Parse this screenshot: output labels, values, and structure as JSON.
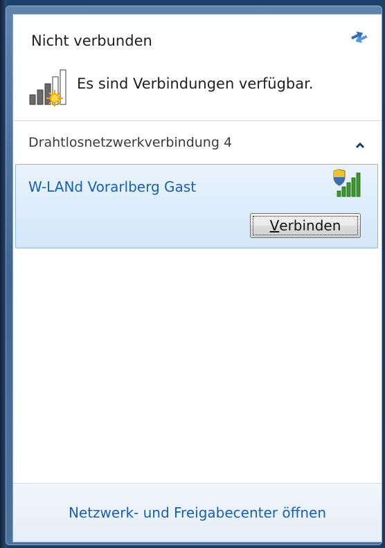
{
  "status": {
    "title": "Nicht verbunden",
    "message": "Es sind Verbindungen verfügbar.",
    "icon": "signal-warning-icon"
  },
  "refresh": {
    "icon": "refresh-arrows-icon"
  },
  "section": {
    "label": "Drahtlosnetzwerkverbindung 4",
    "collapse_icon": "chevron-up-icon"
  },
  "networks": [
    {
      "name": "W-LANd Vorarlberg Gast",
      "secured_icon": "shield-signal-icon",
      "signal_level": "5/5",
      "connect_label_accel": "V",
      "connect_label_rest": "erbinden"
    }
  ],
  "footer": {
    "link": "Netzwerk- und Freigabecenter öffnen"
  },
  "colors": {
    "link": "#1760b0",
    "selection_bg": "#dceaf9",
    "signal_green": "#3a9a2a"
  }
}
